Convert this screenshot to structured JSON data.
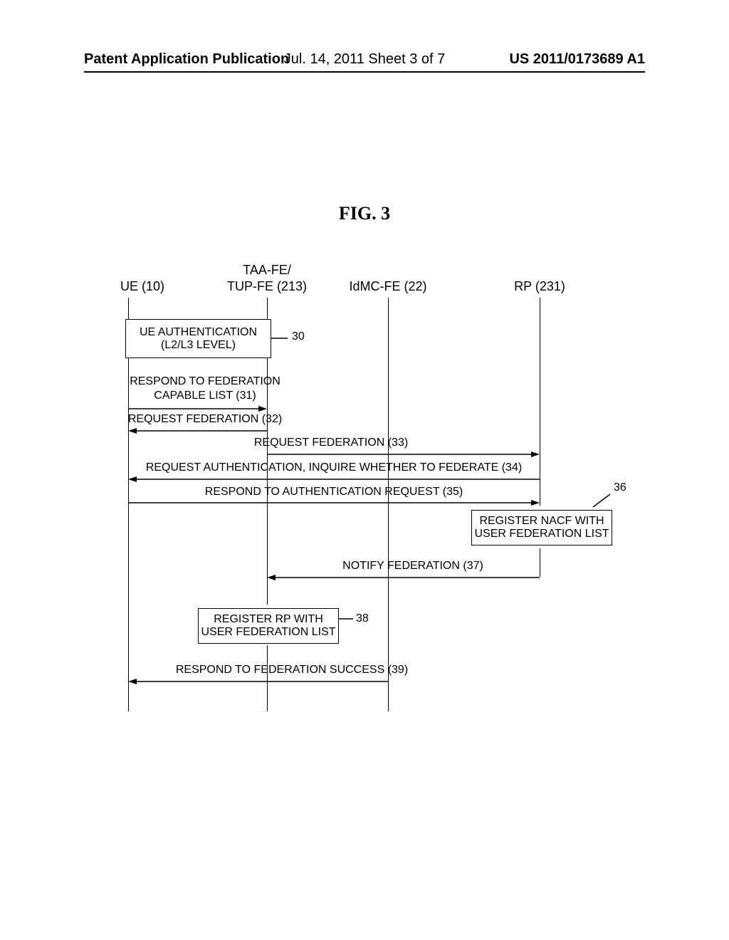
{
  "header": {
    "left": "Patent Application Publication",
    "center": "Jul. 14, 2011  Sheet 3 of 7",
    "right": "US 2011/0173689 A1"
  },
  "figure_title": "FIG.  3",
  "lanes": {
    "ue": {
      "label": "UE (10)",
      "top_label": ""
    },
    "taa": {
      "label_top": "TAA-FE/",
      "label_bottom": "TUP-FE (213)"
    },
    "idmc": {
      "label": "IdMC-FE (22)"
    },
    "rp": {
      "label": "RP (231)"
    }
  },
  "box30": {
    "line1": "UE AUTHENTICATION",
    "line2": "(L2/L3 LEVEL)"
  },
  "callout30": "30",
  "msg31": "RESPOND TO FEDERATION",
  "msg31b": "CAPABLE LIST (31)",
  "msg32": "REQUEST FEDERATION (32)",
  "msg33": "REQUEST FEDERATION (33)",
  "msg34": "REQUEST AUTHENTICATION, INQUIRE WHETHER TO FEDERATE (34)",
  "msg35": "RESPOND TO AUTHENTICATION REQUEST (35)",
  "callout36": "36",
  "box36": {
    "line1": "REGISTER NACF WITH",
    "line2": "USER FEDERATION LIST"
  },
  "msg37": "NOTIFY FEDERATION (37)",
  "box38": {
    "line1": "REGISTER RP WITH",
    "line2": "USER FEDERATION LIST"
  },
  "callout38": "38",
  "msg39": "RESPOND TO FEDERATION SUCCESS (39)"
}
